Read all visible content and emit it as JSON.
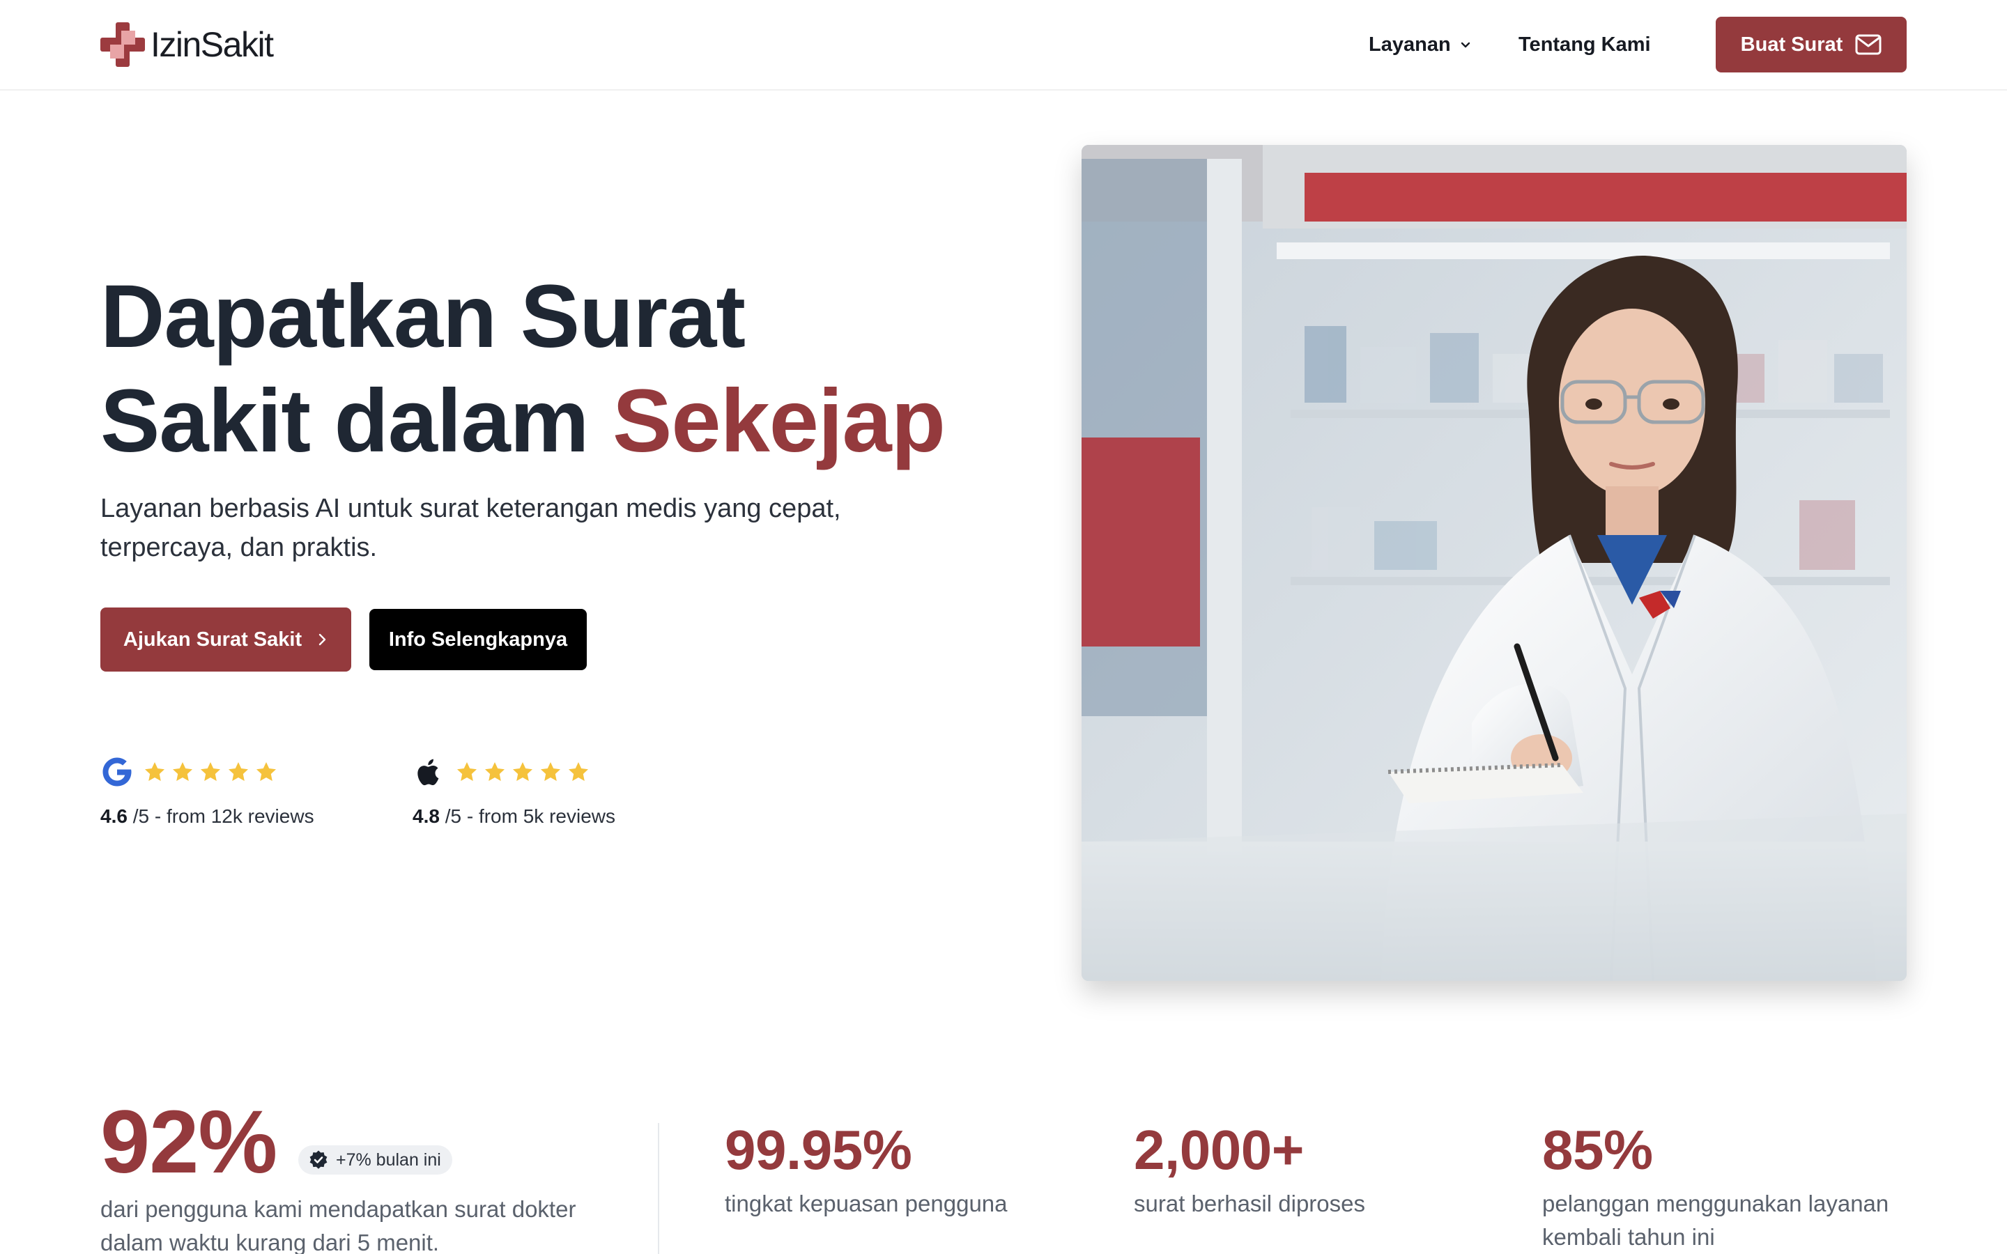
{
  "brand": {
    "name": "IzinSakit",
    "accent": "#943a3d"
  },
  "nav": {
    "layanan": "Layanan",
    "tentang": "Tentang Kami",
    "cta": "Buat Surat"
  },
  "hero": {
    "title_line1": "Dapatkan Surat",
    "title_line2_start": "Sakit dalam ",
    "title_line2_accent": "Sekejap",
    "subtitle": "Layanan berbasis AI untuk surat keterangan medis yang cepat, terpercaya, dan praktis.",
    "primary_cta": "Ajukan Surat Sakit",
    "secondary_cta": "Info Selengkapnya"
  },
  "ratings": [
    {
      "platform": "google-icon",
      "stars": 5,
      "score": "4.6",
      "suffix": " /5 - from 12k reviews"
    },
    {
      "platform": "apple-icon",
      "stars": 5,
      "score": "4.8",
      "suffix": " /5 - from 5k reviews"
    }
  ],
  "stats": {
    "main": {
      "value": "92%",
      "badge": "+7% bulan ini",
      "desc": "dari pengguna kami mendapatkan surat dokter dalam waktu kurang dari 5 menit."
    },
    "items": [
      {
        "value": "99.95%",
        "desc": "tingkat kepuasan pengguna"
      },
      {
        "value": "2,000+",
        "desc": "surat berhasil diproses"
      },
      {
        "value": "85%",
        "desc": "pelanggan menggunakan layanan kembali tahun ini"
      }
    ]
  }
}
